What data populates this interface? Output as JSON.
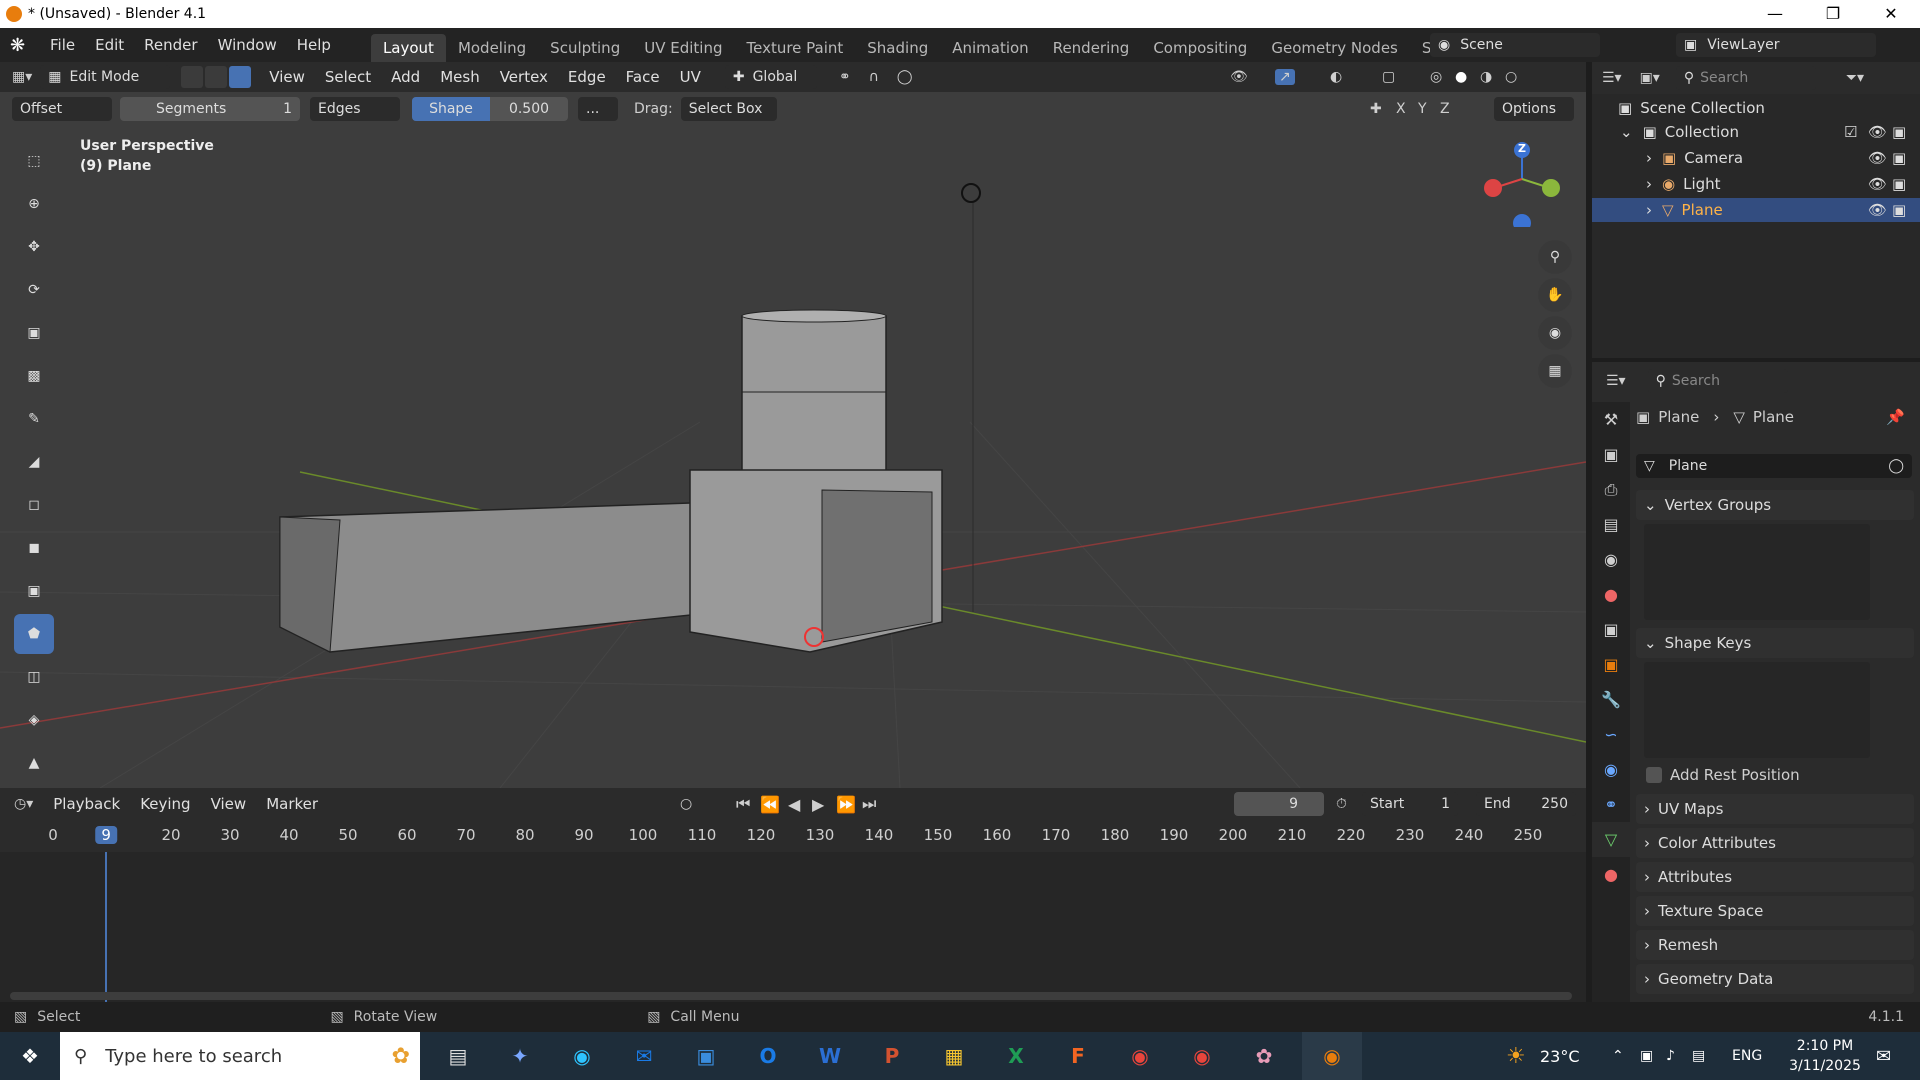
{
  "window": {
    "title": "* (Unsaved) - Blender 4.1"
  },
  "menu": [
    "File",
    "Edit",
    "Render",
    "Window",
    "Help"
  ],
  "workspaces": [
    "Layout",
    "Modeling",
    "Sculpting",
    "UV Editing",
    "Texture Paint",
    "Shading",
    "Animation",
    "Rendering",
    "Compositing",
    "Geometry Nodes",
    "Scripting"
  ],
  "scene": "Scene",
  "view_layer": "ViewLayer",
  "viewport_header": {
    "mode": "Edit Mode",
    "menus": [
      "View",
      "Select",
      "Add",
      "Mesh",
      "Vertex",
      "Edge",
      "Face",
      "UV"
    ],
    "orientation": "Global"
  },
  "operator": {
    "offset": "Offset",
    "segments_label": "Segments",
    "segments_value": "1",
    "affect": "Edges",
    "shape_label": "Shape",
    "shape_value": "0.500",
    "more": "...",
    "drag_label": "Drag:",
    "drag_value": "Select Box",
    "axes": [
      "X",
      "Y",
      "Z"
    ],
    "options": "Options"
  },
  "viewport": {
    "perspective": "User Perspective",
    "object": "(9) Plane",
    "gizmo_z": "Z"
  },
  "outliner": {
    "search_placeholder": "Search",
    "root": "Scene Collection",
    "collection": "Collection",
    "items": [
      "Camera",
      "Light",
      "Plane"
    ]
  },
  "properties": {
    "search_placeholder": "Search",
    "breadcrumb_object": "Plane",
    "breadcrumb_data": "Plane",
    "mesh_name": "Plane",
    "panels": {
      "vertex_groups": "Vertex Groups",
      "shape_keys": "Shape Keys",
      "add_rest_position": "Add Rest Position",
      "uv_maps": "UV Maps",
      "color_attributes": "Color Attributes",
      "attributes": "Attributes",
      "texture_space": "Texture Space",
      "remesh": "Remesh",
      "geometry_data": "Geometry Data"
    }
  },
  "timeline": {
    "menus": [
      "Playback",
      "Keying",
      "View",
      "Marker"
    ],
    "current_frame": "9",
    "start_label": "Start",
    "start": "1",
    "end_label": "End",
    "end": "250",
    "ruler": [
      "0",
      "9",
      "20",
      "30",
      "40",
      "50",
      "60",
      "70",
      "80",
      "90",
      "100",
      "110",
      "120",
      "130",
      "140",
      "150",
      "160",
      "170",
      "180",
      "190",
      "200",
      "210",
      "220",
      "230",
      "240",
      "250"
    ]
  },
  "status": {
    "select": "Select",
    "rotate": "Rotate View",
    "call_menu": "Call Menu",
    "version": "4.1.1"
  },
  "taskbar": {
    "search_placeholder": "Type here to search",
    "weather": "23°C",
    "lang": "ENG",
    "time": "2:10 PM",
    "date": "3/11/2025"
  }
}
